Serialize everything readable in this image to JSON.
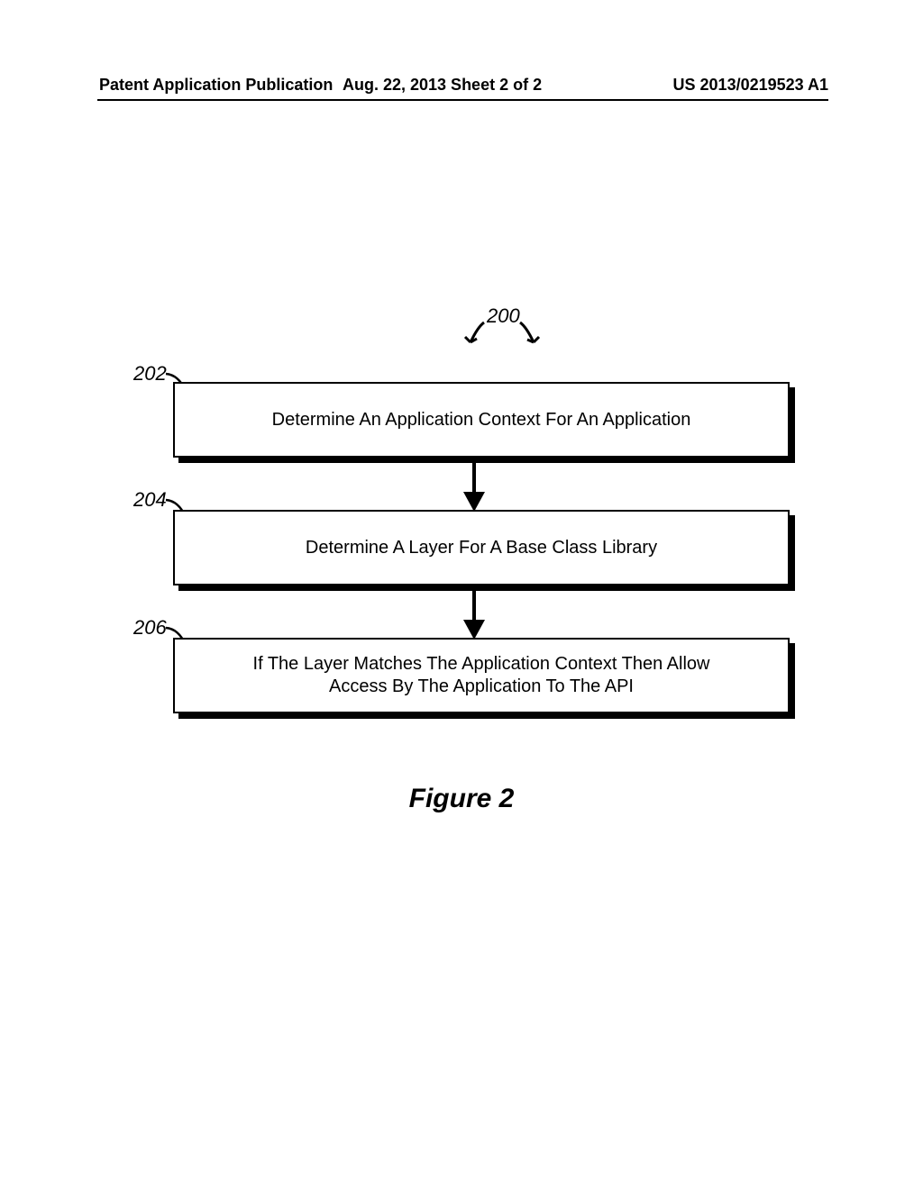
{
  "header": {
    "left": "Patent Application Publication",
    "mid": "Aug. 22, 2013   Sheet 2 of 2",
    "right": "US 2013/0219523 A1"
  },
  "refs": {
    "ref200": "200",
    "ref202": "202",
    "ref204": "204",
    "ref206": "206"
  },
  "boxes": {
    "b202": "Determine An Application Context For An Application",
    "b204": "Determine A Layer For A Base Class Library",
    "b206_line1": "If The Layer Matches The Application Context Then Allow",
    "b206_line2": "Access By The Application To The API"
  },
  "figure_caption": "Figure 2"
}
